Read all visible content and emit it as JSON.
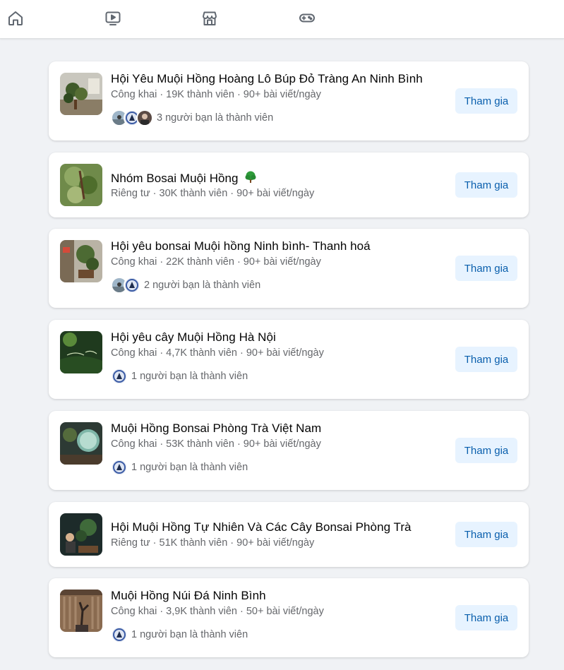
{
  "nav": {
    "icons": [
      "home-icon",
      "video-icon",
      "marketplace-icon",
      "gaming-icon"
    ]
  },
  "colors": {
    "join_bg": "#e7f3ff",
    "join_text": "#0a5fad",
    "page_bg": "#f0f2f5",
    "meta_text": "#65676b"
  },
  "join_label": "Tham gia",
  "groups": [
    {
      "title": "Hội Yêu Muội Hồng Hoàng Lô Búp Đỏ Tràng An Ninh Bình",
      "meta": "Công khai · 19K thành viên · 90+ bài viết/ngày",
      "friends": "3 người bạn là thành viên",
      "friend_count": 3
    },
    {
      "title": "Nhóm Bosai Muội Hồng",
      "meta": "Riêng tư · 30K thành viên · 90+ bài viết/ngày",
      "friends": "",
      "friend_count": 0,
      "title_icon": "tree-icon"
    },
    {
      "title": "Hội yêu bonsai Muội hồng Ninh bình- Thanh hoá",
      "meta": "Công khai · 22K thành viên · 90+ bài viết/ngày",
      "friends": "2 người bạn là thành viên",
      "friend_count": 2
    },
    {
      "title": "Hội yêu cây Muội Hồng Hà Nội",
      "meta": "Công khai · 4,7K thành viên · 90+ bài viết/ngày",
      "friends": "1 người bạn là thành viên",
      "friend_count": 1
    },
    {
      "title": "Muội Hồng Bonsai Phòng Trà Việt Nam",
      "meta": "Công khai · 53K thành viên · 90+ bài viết/ngày",
      "friends": "1 người bạn là thành viên",
      "friend_count": 1
    },
    {
      "title": "Hội Muội Hồng Tự Nhiên Và Các Cây Bonsai Phòng Trà",
      "meta": "Riêng tư · 51K thành viên · 90+ bài viết/ngày",
      "friends": "",
      "friend_count": 0
    },
    {
      "title": "Muội Hồng Núi Đá Ninh Bình",
      "meta": "Công khai · 3,9K thành viên · 50+ bài viết/ngày",
      "friends": "1 người bạn là thành viên",
      "friend_count": 1
    }
  ]
}
